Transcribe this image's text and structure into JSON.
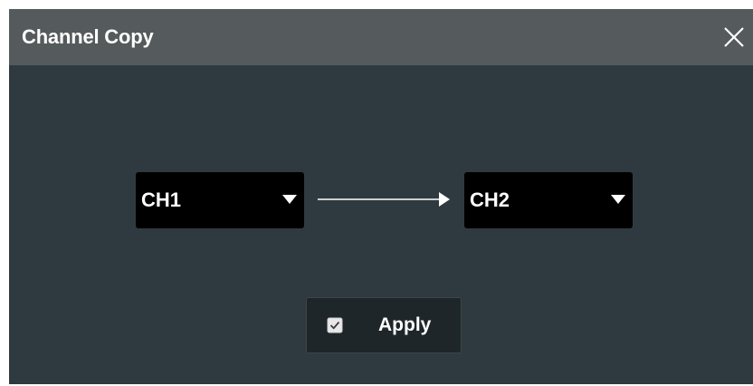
{
  "dialog": {
    "title": "Channel Copy",
    "close_icon": "close-icon"
  },
  "copy": {
    "source": {
      "value": "CH1",
      "icon": "caret-down-icon"
    },
    "arrow_icon": "arrow-right-icon",
    "destination": {
      "value": "CH2",
      "icon": "caret-down-icon"
    }
  },
  "apply": {
    "label": "Apply",
    "checked": true,
    "icon": "checkbox-checked-icon"
  },
  "colors": {
    "dialog_bg": "#2f3a40",
    "titlebar_bg": "#555a5c",
    "select_bg": "#000000",
    "button_bg": "#1f2629",
    "text": "#ffffff"
  }
}
